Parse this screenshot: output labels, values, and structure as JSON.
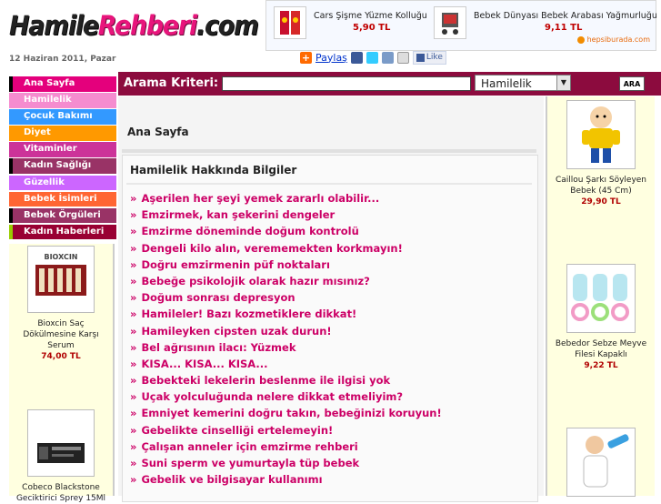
{
  "header": {
    "logo_part1": "Hamile",
    "logo_part2": "Rehberi",
    "logo_part3": ".com",
    "date": "12 Haziran 2011, Pazar"
  },
  "top_ads": {
    "items": [
      {
        "name": "Cars Şişme Yüzme Kolluğu",
        "price": "5,90 TL"
      },
      {
        "name": "Bebek Dünyası Bebek Arabası Yağmurluğu",
        "price": "9,11 TL"
      }
    ],
    "partner": "hepsiburada.com"
  },
  "share": {
    "label": "Paylaş",
    "like_label": "Like"
  },
  "search": {
    "label": "Arama Kriteri:",
    "input_value": "",
    "select_value": "Hamilelik",
    "button_label": "ARA"
  },
  "nav": {
    "items": [
      {
        "label": "Ana Sayfa",
        "color": "#e4007c",
        "marker": "#000000"
      },
      {
        "label": "Hamilelik",
        "color": "#f58ccf",
        "marker": "#f58ccf"
      },
      {
        "label": "Çocuk Bakımı",
        "color": "#3399ff",
        "marker": "#3399ff"
      },
      {
        "label": "Diyet",
        "color": "#ff9900",
        "marker": "#ff9900"
      },
      {
        "label": "Vitaminler",
        "color": "#cc3399",
        "marker": "#cc3399"
      },
      {
        "label": "Kadın Sağlığı",
        "color": "#993366",
        "marker": "#000000"
      },
      {
        "label": "Güzellik",
        "color": "#cc66ff",
        "marker": "#cc66ff"
      },
      {
        "label": "Bebek İsimleri",
        "color": "#ff6633",
        "marker": "#ff6633"
      },
      {
        "label": "Bebek Örgüleri",
        "color": "#993366",
        "marker": "#000000"
      },
      {
        "label": "Kadın Haberleri",
        "color": "#990033",
        "marker": "#99cc00"
      }
    ]
  },
  "left_products": [
    {
      "name": "Bioxcin Saç Dökülmesine Karşı Serum",
      "price": "74,00 TL"
    },
    {
      "name": "Cobeco Blackstone Geciktirici Sprey 15Ml",
      "price": ""
    }
  ],
  "main": {
    "breadcrumb": "Ana Sayfa",
    "section_title": "Hamilelik Hakkında Bilgiler",
    "bullet": "»",
    "articles": [
      "Aşerilen her şeyi yemek zararlı olabilir...",
      "Emzirmek, kan şekerini dengeler",
      "Emzirme döneminde doğum kontrolü",
      "Dengeli kilo alın, verememekten korkmayın!",
      "Doğru emzirmenin püf noktaları",
      "Bebeğe psikolojik olarak hazır mısınız?",
      "Doğum sonrası depresyon",
      "Hamileler! Bazı kozmetiklere dikkat!",
      "Hamileyken cipsten uzak durun!",
      "Bel ağrısının ilacı: Yüzmek",
      "KISA... KISA... KISA...",
      "Bebekteki lekelerin beslenme ile ilgisi yok",
      "Uçak yolculuğunda nelere dikkat etmeliyim?",
      "Emniyet kemerini doğru takın, bebeğinizi koruyun!",
      "Gebelikte cinselliği ertelemeyin!",
      "Çalışan anneler için emzirme rehberi",
      "Suni sperm ve yumurtayla tüp bebek",
      "Gebelik ve bilgisayar kullanımı"
    ]
  },
  "right_products": [
    {
      "name": "Caillou Şarkı Söyleyen Bebek (45 Cm)",
      "price": "29,90 TL"
    },
    {
      "name": "Bebedor Sebze Meyve Filesi Kapaklı",
      "price": "9,22 TL"
    },
    {
      "name": "",
      "price": ""
    }
  ]
}
